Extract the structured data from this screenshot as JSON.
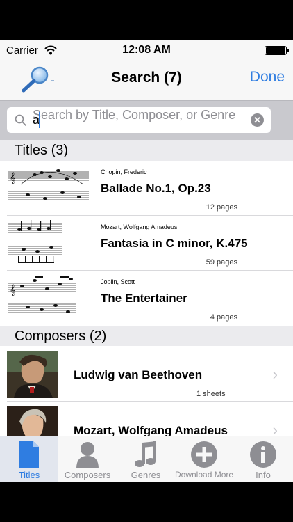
{
  "status_bar": {
    "carrier": "Carrier",
    "time": "12:08 AM"
  },
  "nav": {
    "title": "Search (7)",
    "done_label": "Done"
  },
  "search": {
    "placeholder": "Search by Title, Composer, or Genre",
    "value": "a"
  },
  "titles_section": {
    "header": "Titles (3)",
    "rows": [
      {
        "composer": "Chopin, Frederic",
        "title": "Ballade No.1, Op.23",
        "pages": "12 pages"
      },
      {
        "composer": "Mozart, Wolfgang Amadeus",
        "title": "Fantasia in C minor, K.475",
        "pages": "59 pages"
      },
      {
        "composer": "Joplin, Scott",
        "title": "The Entertainer",
        "pages": "4 pages"
      }
    ]
  },
  "composers_section": {
    "header": "Composers (2)",
    "rows": [
      {
        "name": "Ludwig van Beethoven",
        "count": "1 sheets"
      },
      {
        "name": "Mozart, Wolfgang Amadeus",
        "count": ""
      }
    ]
  },
  "tabbar": {
    "items": [
      {
        "label": "Titles",
        "icon": "document-icon",
        "active": true
      },
      {
        "label": "Composers",
        "icon": "person-icon",
        "active": false
      },
      {
        "label": "Genres",
        "icon": "music-note-icon",
        "active": false
      },
      {
        "label": "Download More",
        "icon": "plus-circle-icon",
        "active": false
      },
      {
        "label": "Info",
        "icon": "info-icon",
        "active": false
      }
    ]
  },
  "colors": {
    "accent": "#2f7de1",
    "section_bg": "#ebebee",
    "search_bg": "#c9c9ce"
  }
}
